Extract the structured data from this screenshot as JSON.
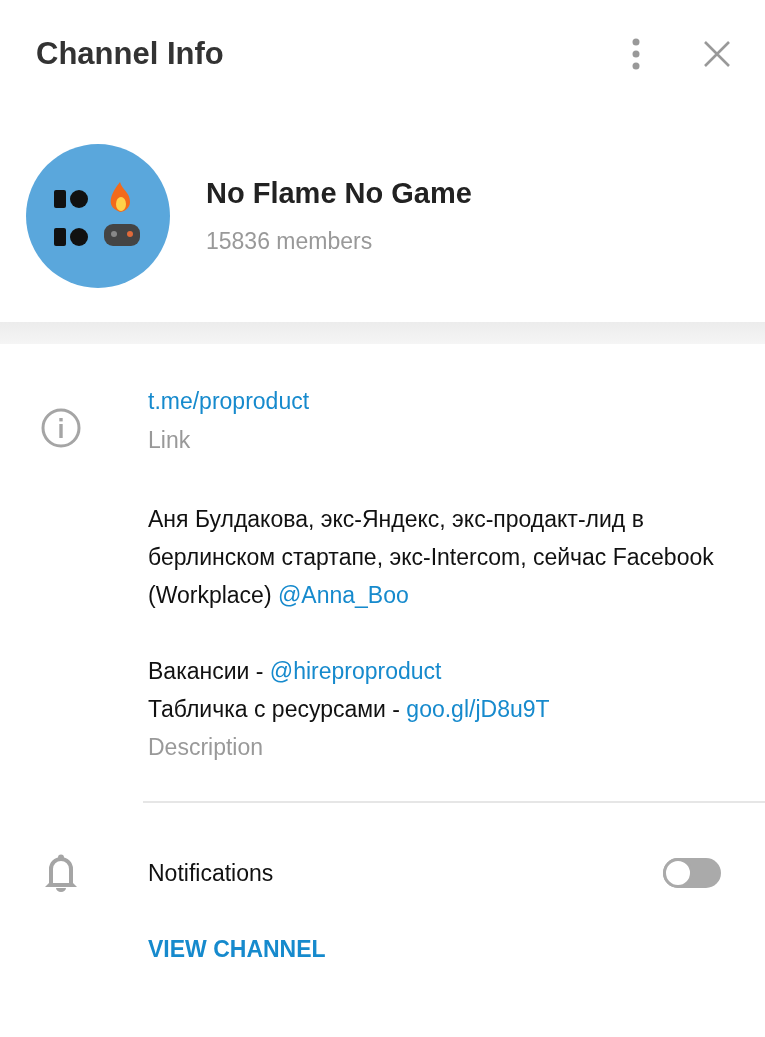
{
  "header": {
    "title": "Channel Info"
  },
  "channel": {
    "name": "No Flame No Game",
    "members": "15836 members"
  },
  "link": {
    "value": "t.me/proproduct",
    "label": "Link"
  },
  "description": {
    "blocks": [
      [
        [
          {
            "kind": "text",
            "text": "Аня Булдакова, экс-Яндекс, экс-продакт-лид в берлинском стартапе, экс-Intercom, сейчас Facebook (Workplace) "
          },
          {
            "kind": "link",
            "text": "@Anna_Boo"
          }
        ]
      ],
      [
        [
          {
            "kind": "text",
            "text": "Вакансии - "
          },
          {
            "kind": "link",
            "text": "@hireproproduct"
          }
        ],
        [
          {
            "kind": "text",
            "text": "Табличка с ресурсами - "
          },
          {
            "kind": "link",
            "text": "goo.gl/jD8u9T"
          }
        ]
      ]
    ],
    "label": "Description"
  },
  "notifications": {
    "label": "Notifications",
    "on": false
  },
  "action": "VIEW CHANNEL"
}
